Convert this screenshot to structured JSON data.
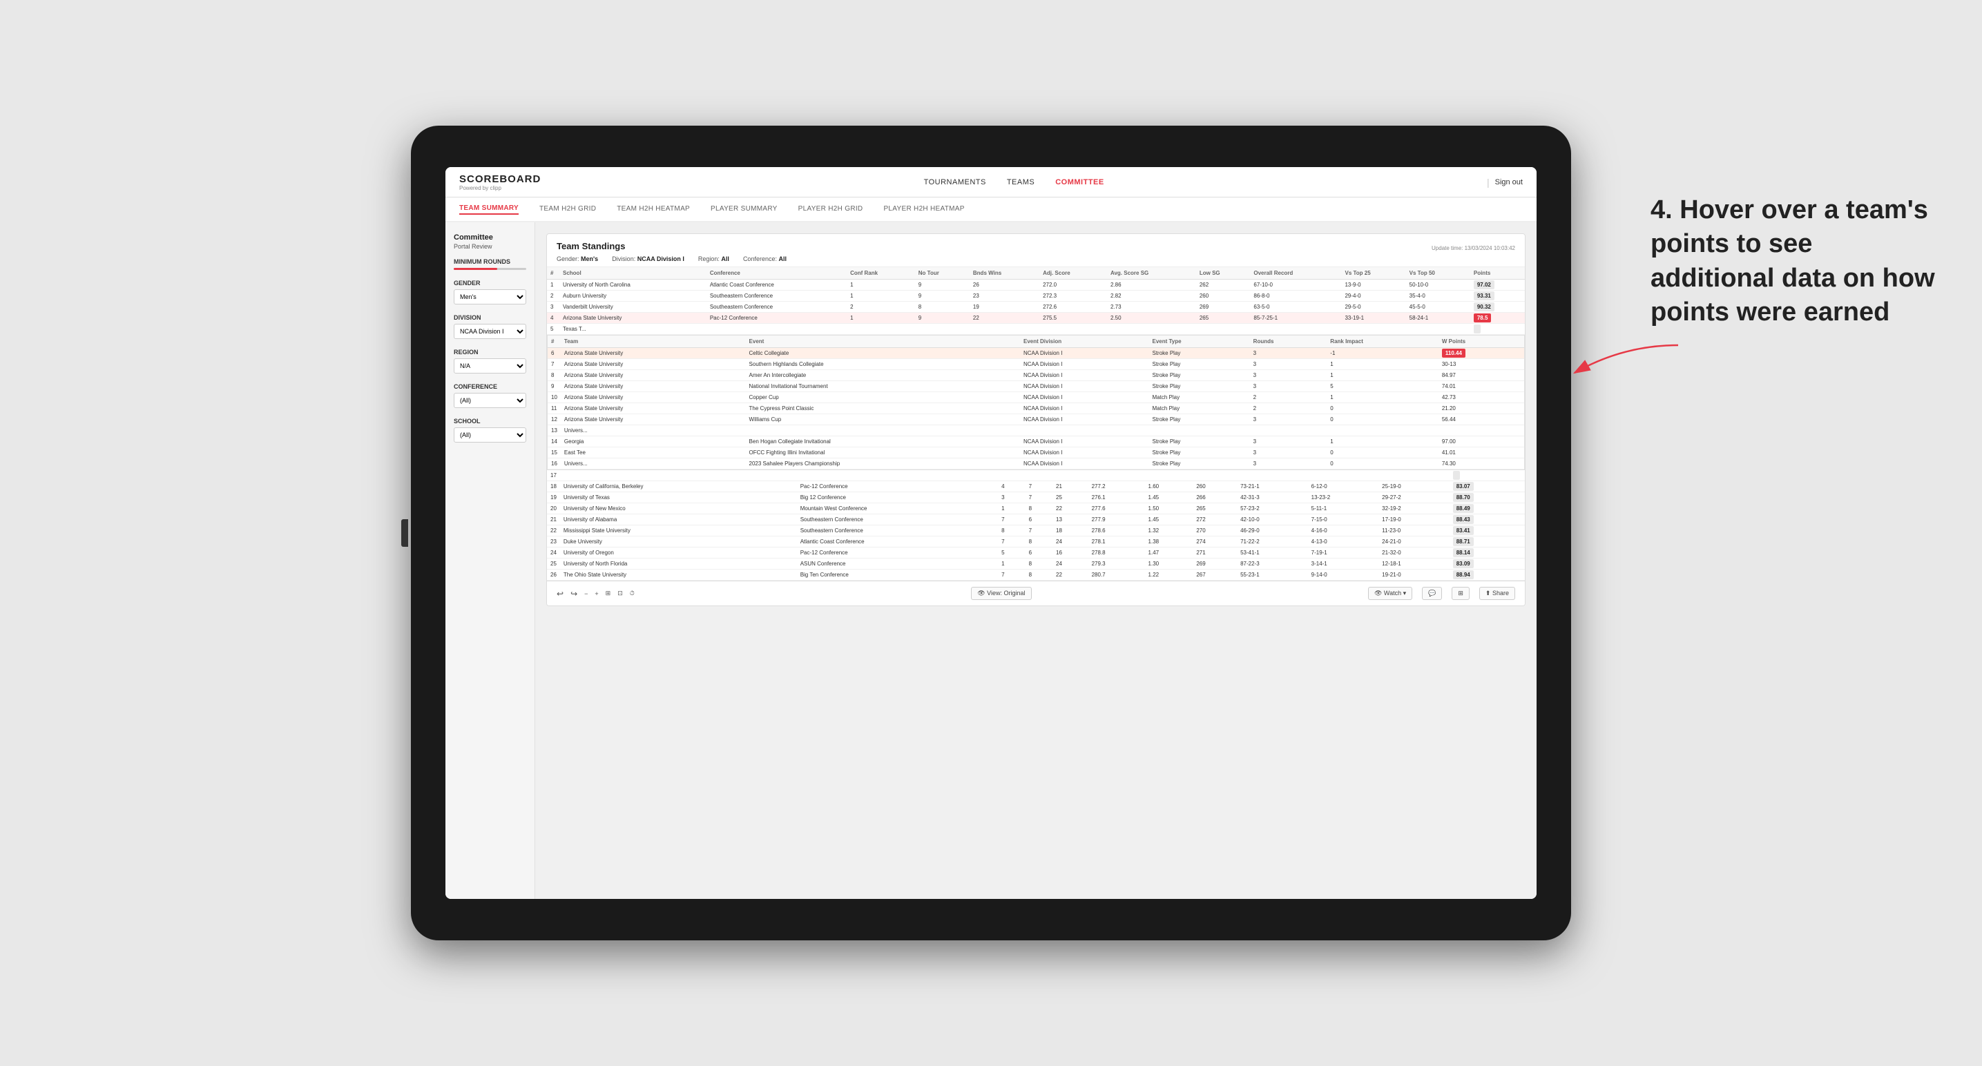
{
  "app": {
    "logo": "SCOREBOARD",
    "logo_powered": "Powered by clipp"
  },
  "top_nav": {
    "links": [
      "TOURNAMENTS",
      "TEAMS",
      "COMMITTEE"
    ],
    "active_link": "COMMITTEE",
    "sign_out": "Sign out"
  },
  "sub_nav": {
    "links": [
      "TEAM SUMMARY",
      "TEAM H2H GRID",
      "TEAM H2H HEATMAP",
      "PLAYER SUMMARY",
      "PLAYER H2H GRID",
      "PLAYER H2H HEATMAP"
    ],
    "active_link": "TEAM SUMMARY"
  },
  "left_panel": {
    "title": "Committee",
    "subtitle": "Portal Review",
    "filters": [
      {
        "label": "Minimum Rounds",
        "type": "slider"
      },
      {
        "label": "Gender",
        "type": "select",
        "value": "Men's"
      },
      {
        "label": "Division",
        "type": "select",
        "value": "NCAA Division I"
      },
      {
        "label": "Region",
        "type": "select",
        "value": "N/A"
      },
      {
        "label": "Conference",
        "type": "select",
        "value": "(All)"
      },
      {
        "label": "School",
        "type": "select",
        "value": "(All)"
      }
    ]
  },
  "standings": {
    "title": "Team Standings",
    "update_time": "Update time: 13/03/2024 10:03:42",
    "filters": {
      "gender": "Men's",
      "division": "NCAA Division I",
      "region": "All",
      "conference": "All"
    },
    "columns": [
      "#",
      "School",
      "Conference",
      "Conf Rank",
      "No Tour",
      "Bnds Wins",
      "Adj. Score",
      "Avg. Score SG",
      "Low SG",
      "Overall Record",
      "Vs Top 25",
      "Vs Top 50",
      "Points"
    ],
    "rows": [
      {
        "num": 1,
        "school": "University of North Carolina",
        "conference": "Atlantic Coast Conference",
        "conf_rank": 1,
        "no_tour": 9,
        "bnds_wins": 26,
        "adj_score": 272.0,
        "avg_score": 2.86,
        "low_sg": 262,
        "overall": "67-10-0",
        "vs25": "13-9-0",
        "vs50": "50-10-0",
        "points": "97.02",
        "highlight": false
      },
      {
        "num": 2,
        "school": "Auburn University",
        "conference": "Southeastern Conference",
        "conf_rank": 1,
        "no_tour": 9,
        "bnds_wins": 23,
        "adj_score": 272.3,
        "avg_score": 2.82,
        "low_sg": 260,
        "overall": "86-8-0",
        "vs25": "29-4-0",
        "vs50": "35-4-0",
        "points": "93.31",
        "highlight": false
      },
      {
        "num": 3,
        "school": "Vanderbilt University",
        "conference": "Southeastern Conference",
        "conf_rank": 2,
        "no_tour": 8,
        "bnds_wins": 19,
        "adj_score": 272.6,
        "avg_score": 2.73,
        "low_sg": 269,
        "overall": "63-5-0",
        "vs25": "29-5-0",
        "vs50": "45-5-0",
        "points": "90.32",
        "highlight": false
      },
      {
        "num": 4,
        "school": "Arizona State University",
        "conference": "Pac-12 Conference",
        "conf_rank": 1,
        "no_tour": 9,
        "bnds_wins": 22,
        "adj_score": 275.5,
        "avg_score": 2.5,
        "low_sg": 265,
        "overall": "85-7-25-1",
        "vs25": "33-19-1",
        "vs50": "58-24-1",
        "points": "78.5",
        "highlight": true
      },
      {
        "num": 5,
        "school": "Texas T...",
        "conference": "",
        "conf_rank": "",
        "no_tour": "",
        "bnds_wins": "",
        "adj_score": "",
        "avg_score": "",
        "low_sg": "",
        "overall": "",
        "vs25": "",
        "vs50": "",
        "points": "",
        "highlight": false
      }
    ],
    "tooltip_rows": [
      {
        "num": 6,
        "school": "Univers...",
        "team": "Arizona State University",
        "event": "Celtic Collegiate",
        "event_division": "NCAA Division I",
        "event_type": "Stroke Play",
        "rounds": 3,
        "rank_impact": -1,
        "points": "110.44",
        "highlight": true
      },
      {
        "num": 7,
        "school": "Univers...",
        "team": "Arizona State University",
        "event": "Southern Highlands Collegiate",
        "event_division": "NCAA Division I",
        "event_type": "Stroke Play",
        "rounds": 3,
        "rank_impact": 1,
        "points": "30-13"
      },
      {
        "num": 8,
        "school": "Univers...",
        "team": "Arizona State University",
        "event": "Amer An Intercollegiate",
        "event_division": "NCAA Division I",
        "event_type": "Stroke Play",
        "rounds": 3,
        "rank_impact": 1,
        "points": "84.97"
      },
      {
        "num": 9,
        "school": "Univers...",
        "team": "Arizona State University",
        "event": "National Invitational Tournament",
        "event_division": "NCAA Division I",
        "event_type": "Stroke Play",
        "rounds": 3,
        "rank_impact": 5,
        "points": "74.01"
      },
      {
        "num": 10,
        "school": "Univers...",
        "team": "Arizona State University",
        "event": "Copper Cup",
        "event_division": "NCAA Division I",
        "event_type": "Match Play",
        "rounds": 2,
        "rank_impact": 1,
        "points": "42.73"
      },
      {
        "num": 11,
        "school": "Univers...",
        "team": "Arizona State University",
        "event": "The Cypress Point Classic",
        "event_division": "NCAA Division I",
        "event_type": "Match Play",
        "rounds": 2,
        "rank_impact": 0,
        "points": "21.20"
      },
      {
        "num": 12,
        "school": "Univers...",
        "team": "Arizona State University",
        "event": "Williams Cup",
        "event_division": "NCAA Division I",
        "event_type": "Stroke Play",
        "rounds": 3,
        "rank_impact": 0,
        "points": "56.44"
      },
      {
        "num": 13,
        "school": "Univers...",
        "team": "Arizona State University",
        "event": "",
        "event_division": "",
        "event_type": "",
        "rounds": "",
        "rank_impact": "",
        "points": ""
      },
      {
        "num": 14,
        "school": "Georgia",
        "team": "Georgia",
        "event": "Ben Hogan Collegiate Invitational",
        "event_division": "NCAA Division I",
        "event_type": "Stroke Play",
        "rounds": 3,
        "rank_impact": 1,
        "points": "97.00"
      },
      {
        "num": 15,
        "school": "East Tee",
        "team": "",
        "event": "OFCC Fighting Illini Invitational",
        "event_division": "NCAA Division I",
        "event_type": "Stroke Play",
        "rounds": 3,
        "rank_impact": 0,
        "points": "41.01"
      },
      {
        "num": 16,
        "school": "Univers...",
        "team": "",
        "event": "2023 Sahalee Players Championship",
        "event_division": "NCAA Division I",
        "event_type": "Stroke Play",
        "rounds": 3,
        "rank_impact": 0,
        "points": "74.30"
      }
    ],
    "main_rows": [
      {
        "num": 17,
        "school": "",
        "conference": "",
        "conf_rank": "",
        "no_tour": "",
        "bnds_wins": "",
        "adj_score": "",
        "avg_score": "",
        "low_sg": "",
        "overall": "",
        "vs25": "",
        "vs50": "",
        "points": ""
      },
      {
        "num": 18,
        "school": "University of California, Berkeley",
        "conference": "Pac-12 Conference",
        "conf_rank": 4,
        "no_tour": 7,
        "bnds_wins": 21,
        "adj_score": 277.2,
        "avg_score": 1.6,
        "low_sg": 260,
        "overall": "73-21-1",
        "vs25": "6-12-0",
        "vs50": "25-19-0",
        "points": "83.07"
      },
      {
        "num": 19,
        "school": "University of Texas",
        "conference": "Big 12 Conference",
        "conf_rank": 3,
        "no_tour": 7,
        "bnds_wins": 25,
        "adj_score": 276.1,
        "avg_score": 1.45,
        "low_sg": 266,
        "overall": "42-31-3",
        "vs25": "13-23-2",
        "vs50": "29-27-2",
        "points": "88.70"
      },
      {
        "num": 20,
        "school": "University of New Mexico",
        "conference": "Mountain West Conference",
        "conf_rank": 1,
        "no_tour": 8,
        "bnds_wins": 22,
        "adj_score": 277.6,
        "avg_score": 1.5,
        "low_sg": 265,
        "overall": "57-23-2",
        "vs25": "5-11-1",
        "vs50": "32-19-2",
        "points": "88.49"
      },
      {
        "num": 21,
        "school": "University of Alabama",
        "conference": "Southeastern Conference",
        "conf_rank": 7,
        "no_tour": 6,
        "bnds_wins": 13,
        "adj_score": 277.9,
        "avg_score": 1.45,
        "low_sg": 272,
        "overall": "42-10-0",
        "vs25": "7-15-0",
        "vs50": "17-19-0",
        "points": "88.43"
      },
      {
        "num": 22,
        "school": "Mississippi State University",
        "conference": "Southeastern Conference",
        "conf_rank": 8,
        "no_tour": 7,
        "bnds_wins": 18,
        "adj_score": 278.6,
        "avg_score": 1.32,
        "low_sg": 270,
        "overall": "46-29-0",
        "vs25": "4-16-0",
        "vs50": "11-23-0",
        "points": "83.41"
      },
      {
        "num": 23,
        "school": "Duke University",
        "conference": "Atlantic Coast Conference",
        "conf_rank": 7,
        "no_tour": 8,
        "bnds_wins": 24,
        "adj_score": 278.1,
        "avg_score": 1.38,
        "low_sg": 274,
        "overall": "71-22-2",
        "vs25": "4-13-0",
        "vs50": "24-21-0",
        "points": "88.71"
      },
      {
        "num": 24,
        "school": "University of Oregon",
        "conference": "Pac-12 Conference",
        "conf_rank": 5,
        "no_tour": 6,
        "bnds_wins": 16,
        "adj_score": 278.8,
        "avg_score": 1.47,
        "low_sg": 271,
        "overall": "53-41-1",
        "vs25": "7-19-1",
        "vs50": "21-32-0",
        "points": "88.14"
      },
      {
        "num": 25,
        "school": "University of North Florida",
        "conference": "ASUN Conference",
        "conf_rank": 1,
        "no_tour": 8,
        "bnds_wins": 24,
        "adj_score": 279.3,
        "avg_score": 1.3,
        "low_sg": 269,
        "overall": "87-22-3",
        "vs25": "3-14-1",
        "vs50": "12-18-1",
        "points": "83.09"
      },
      {
        "num": 26,
        "school": "The Ohio State University",
        "conference": "Big Ten Conference",
        "conf_rank": 7,
        "no_tour": 8,
        "bnds_wins": 22,
        "adj_score": 280.7,
        "avg_score": 1.22,
        "low_sg": 267,
        "overall": "55-23-1",
        "vs25": "9-14-0",
        "vs50": "19-21-0",
        "points": "88.94"
      }
    ]
  },
  "toolbar": {
    "undo": "↩",
    "redo": "↪",
    "zoom_out": "−",
    "zoom_in": "+",
    "copy": "⊞",
    "paste": "⊡",
    "timer": "⏱",
    "view_label": "View: Original",
    "watch_label": "Watch",
    "share_label": "Share"
  },
  "annotation": {
    "text": "4. Hover over a team's points to see additional data on how points were earned"
  }
}
